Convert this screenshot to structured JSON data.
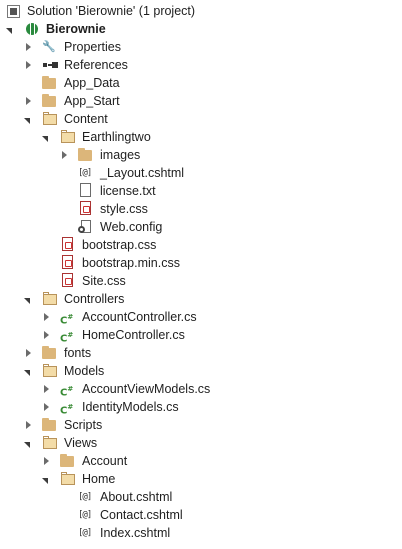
{
  "solution_label": "Solution 'Bierownie' (1 project)",
  "items": [
    {
      "label": "Bierownie",
      "icon": "web-project-icon",
      "level": 0,
      "expander": "expanded",
      "bold": true
    },
    {
      "label": "Properties",
      "icon": "wrench-icon",
      "level": 1,
      "expander": "collapsed"
    },
    {
      "label": "References",
      "icon": "references-icon",
      "level": 1,
      "expander": "collapsed"
    },
    {
      "label": "App_Data",
      "icon": "folder-icon",
      "level": 1,
      "expander": "none"
    },
    {
      "label": "App_Start",
      "icon": "folder-icon",
      "level": 1,
      "expander": "collapsed"
    },
    {
      "label": "Content",
      "icon": "folder-open-icon",
      "level": 1,
      "expander": "expanded"
    },
    {
      "label": "Earthlingtwo",
      "icon": "folder-open-icon",
      "level": 2,
      "expander": "expanded"
    },
    {
      "label": "images",
      "icon": "folder-icon",
      "level": 3,
      "expander": "collapsed"
    },
    {
      "label": "_Layout.cshtml",
      "icon": "cshtml-file-icon",
      "level": 3,
      "expander": "none"
    },
    {
      "label": "license.txt",
      "icon": "text-file-icon",
      "level": 3,
      "expander": "none"
    },
    {
      "label": "style.css",
      "icon": "css-file-icon",
      "level": 3,
      "expander": "none"
    },
    {
      "label": "Web.config",
      "icon": "config-file-icon",
      "level": 3,
      "expander": "none"
    },
    {
      "label": "bootstrap.css",
      "icon": "css-file-icon",
      "level": 2,
      "expander": "none"
    },
    {
      "label": "bootstrap.min.css",
      "icon": "css-file-icon",
      "level": 2,
      "expander": "none"
    },
    {
      "label": "Site.css",
      "icon": "css-file-icon",
      "level": 2,
      "expander": "none"
    },
    {
      "label": "Controllers",
      "icon": "folder-open-icon",
      "level": 1,
      "expander": "expanded"
    },
    {
      "label": "AccountController.cs",
      "icon": "csharp-file-icon",
      "level": 2,
      "expander": "collapsed"
    },
    {
      "label": "HomeController.cs",
      "icon": "csharp-file-icon",
      "level": 2,
      "expander": "collapsed"
    },
    {
      "label": "fonts",
      "icon": "folder-icon",
      "level": 1,
      "expander": "collapsed"
    },
    {
      "label": "Models",
      "icon": "folder-open-icon",
      "level": 1,
      "expander": "expanded"
    },
    {
      "label": "AccountViewModels.cs",
      "icon": "csharp-file-icon",
      "level": 2,
      "expander": "collapsed"
    },
    {
      "label": "IdentityModels.cs",
      "icon": "csharp-file-icon",
      "level": 2,
      "expander": "collapsed"
    },
    {
      "label": "Scripts",
      "icon": "folder-icon",
      "level": 1,
      "expander": "collapsed"
    },
    {
      "label": "Views",
      "icon": "folder-open-icon",
      "level": 1,
      "expander": "expanded"
    },
    {
      "label": "Account",
      "icon": "folder-icon",
      "level": 2,
      "expander": "collapsed"
    },
    {
      "label": "Home",
      "icon": "folder-open-icon",
      "level": 2,
      "expander": "expanded"
    },
    {
      "label": "About.cshtml",
      "icon": "cshtml-file-icon",
      "level": 3,
      "expander": "none"
    },
    {
      "label": "Contact.cshtml",
      "icon": "cshtml-file-icon",
      "level": 3,
      "expander": "none"
    },
    {
      "label": "Index.cshtml",
      "icon": "cshtml-file-icon",
      "level": 3,
      "expander": "none"
    }
  ],
  "colors": {
    "folder": "#dcb67a",
    "csharp": "#388a34",
    "text": "#1e1e1e"
  }
}
